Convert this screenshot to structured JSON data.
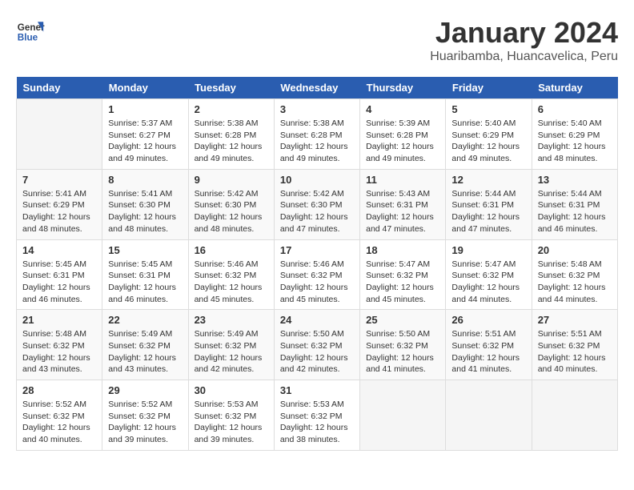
{
  "logo": {
    "text_general": "General",
    "text_blue": "Blue"
  },
  "title": "January 2024",
  "subtitle": "Huaribamba, Huancavelica, Peru",
  "days_header": [
    "Sunday",
    "Monday",
    "Tuesday",
    "Wednesday",
    "Thursday",
    "Friday",
    "Saturday"
  ],
  "weeks": [
    [
      {
        "num": "",
        "info": ""
      },
      {
        "num": "1",
        "info": "Sunrise: 5:37 AM\nSunset: 6:27 PM\nDaylight: 12 hours\nand 49 minutes."
      },
      {
        "num": "2",
        "info": "Sunrise: 5:38 AM\nSunset: 6:28 PM\nDaylight: 12 hours\nand 49 minutes."
      },
      {
        "num": "3",
        "info": "Sunrise: 5:38 AM\nSunset: 6:28 PM\nDaylight: 12 hours\nand 49 minutes."
      },
      {
        "num": "4",
        "info": "Sunrise: 5:39 AM\nSunset: 6:28 PM\nDaylight: 12 hours\nand 49 minutes."
      },
      {
        "num": "5",
        "info": "Sunrise: 5:40 AM\nSunset: 6:29 PM\nDaylight: 12 hours\nand 49 minutes."
      },
      {
        "num": "6",
        "info": "Sunrise: 5:40 AM\nSunset: 6:29 PM\nDaylight: 12 hours\nand 48 minutes."
      }
    ],
    [
      {
        "num": "7",
        "info": "Sunrise: 5:41 AM\nSunset: 6:29 PM\nDaylight: 12 hours\nand 48 minutes."
      },
      {
        "num": "8",
        "info": "Sunrise: 5:41 AM\nSunset: 6:30 PM\nDaylight: 12 hours\nand 48 minutes."
      },
      {
        "num": "9",
        "info": "Sunrise: 5:42 AM\nSunset: 6:30 PM\nDaylight: 12 hours\nand 48 minutes."
      },
      {
        "num": "10",
        "info": "Sunrise: 5:42 AM\nSunset: 6:30 PM\nDaylight: 12 hours\nand 47 minutes."
      },
      {
        "num": "11",
        "info": "Sunrise: 5:43 AM\nSunset: 6:31 PM\nDaylight: 12 hours\nand 47 minutes."
      },
      {
        "num": "12",
        "info": "Sunrise: 5:44 AM\nSunset: 6:31 PM\nDaylight: 12 hours\nand 47 minutes."
      },
      {
        "num": "13",
        "info": "Sunrise: 5:44 AM\nSunset: 6:31 PM\nDaylight: 12 hours\nand 46 minutes."
      }
    ],
    [
      {
        "num": "14",
        "info": "Sunrise: 5:45 AM\nSunset: 6:31 PM\nDaylight: 12 hours\nand 46 minutes."
      },
      {
        "num": "15",
        "info": "Sunrise: 5:45 AM\nSunset: 6:31 PM\nDaylight: 12 hours\nand 46 minutes."
      },
      {
        "num": "16",
        "info": "Sunrise: 5:46 AM\nSunset: 6:32 PM\nDaylight: 12 hours\nand 45 minutes."
      },
      {
        "num": "17",
        "info": "Sunrise: 5:46 AM\nSunset: 6:32 PM\nDaylight: 12 hours\nand 45 minutes."
      },
      {
        "num": "18",
        "info": "Sunrise: 5:47 AM\nSunset: 6:32 PM\nDaylight: 12 hours\nand 45 minutes."
      },
      {
        "num": "19",
        "info": "Sunrise: 5:47 AM\nSunset: 6:32 PM\nDaylight: 12 hours\nand 44 minutes."
      },
      {
        "num": "20",
        "info": "Sunrise: 5:48 AM\nSunset: 6:32 PM\nDaylight: 12 hours\nand 44 minutes."
      }
    ],
    [
      {
        "num": "21",
        "info": "Sunrise: 5:48 AM\nSunset: 6:32 PM\nDaylight: 12 hours\nand 43 minutes."
      },
      {
        "num": "22",
        "info": "Sunrise: 5:49 AM\nSunset: 6:32 PM\nDaylight: 12 hours\nand 43 minutes."
      },
      {
        "num": "23",
        "info": "Sunrise: 5:49 AM\nSunset: 6:32 PM\nDaylight: 12 hours\nand 42 minutes."
      },
      {
        "num": "24",
        "info": "Sunrise: 5:50 AM\nSunset: 6:32 PM\nDaylight: 12 hours\nand 42 minutes."
      },
      {
        "num": "25",
        "info": "Sunrise: 5:50 AM\nSunset: 6:32 PM\nDaylight: 12 hours\nand 41 minutes."
      },
      {
        "num": "26",
        "info": "Sunrise: 5:51 AM\nSunset: 6:32 PM\nDaylight: 12 hours\nand 41 minutes."
      },
      {
        "num": "27",
        "info": "Sunrise: 5:51 AM\nSunset: 6:32 PM\nDaylight: 12 hours\nand 40 minutes."
      }
    ],
    [
      {
        "num": "28",
        "info": "Sunrise: 5:52 AM\nSunset: 6:32 PM\nDaylight: 12 hours\nand 40 minutes."
      },
      {
        "num": "29",
        "info": "Sunrise: 5:52 AM\nSunset: 6:32 PM\nDaylight: 12 hours\nand 39 minutes."
      },
      {
        "num": "30",
        "info": "Sunrise: 5:53 AM\nSunset: 6:32 PM\nDaylight: 12 hours\nand 39 minutes."
      },
      {
        "num": "31",
        "info": "Sunrise: 5:53 AM\nSunset: 6:32 PM\nDaylight: 12 hours\nand 38 minutes."
      },
      {
        "num": "",
        "info": ""
      },
      {
        "num": "",
        "info": ""
      },
      {
        "num": "",
        "info": ""
      }
    ]
  ]
}
